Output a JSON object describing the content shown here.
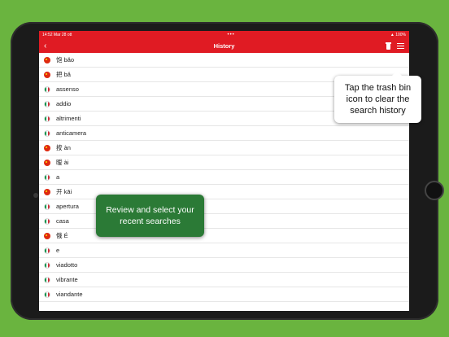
{
  "status_bar": {
    "time": "14:52",
    "date": "Mar 28 ott",
    "dots": "•••",
    "battery": "100%"
  },
  "nav": {
    "title": "History",
    "back_icon": "chevron-left-icon",
    "trash_icon": "trash-icon",
    "menu_icon": "menu-icon"
  },
  "colors": {
    "accent": "#e01b23",
    "background": "#6ab43f",
    "callout_green": "#2b7a36"
  },
  "history": [
    {
      "flag": "cn",
      "text": "饱 bǎo"
    },
    {
      "flag": "cn",
      "text": "把 bǎ"
    },
    {
      "flag": "it",
      "text": "assenso"
    },
    {
      "flag": "it",
      "text": "addio"
    },
    {
      "flag": "it",
      "text": "altrimenti"
    },
    {
      "flag": "it",
      "text": "anticamera"
    },
    {
      "flag": "cn",
      "text": "按 àn"
    },
    {
      "flag": "cn",
      "text": "暧 ài"
    },
    {
      "flag": "it",
      "text": "a"
    },
    {
      "flag": "cn",
      "text": "开 kāi"
    },
    {
      "flag": "it",
      "text": "apertura"
    },
    {
      "flag": "it",
      "text": "casa"
    },
    {
      "flag": "cn",
      "text": "俄 É"
    },
    {
      "flag": "it",
      "text": "e"
    },
    {
      "flag": "it",
      "text": "viadotto"
    },
    {
      "flag": "it",
      "text": "vibrante"
    },
    {
      "flag": "it",
      "text": "viandante"
    }
  ],
  "callouts": {
    "trash": "Tap the trash bin icon to clear the search history",
    "review": "Review and select your recent searches"
  }
}
